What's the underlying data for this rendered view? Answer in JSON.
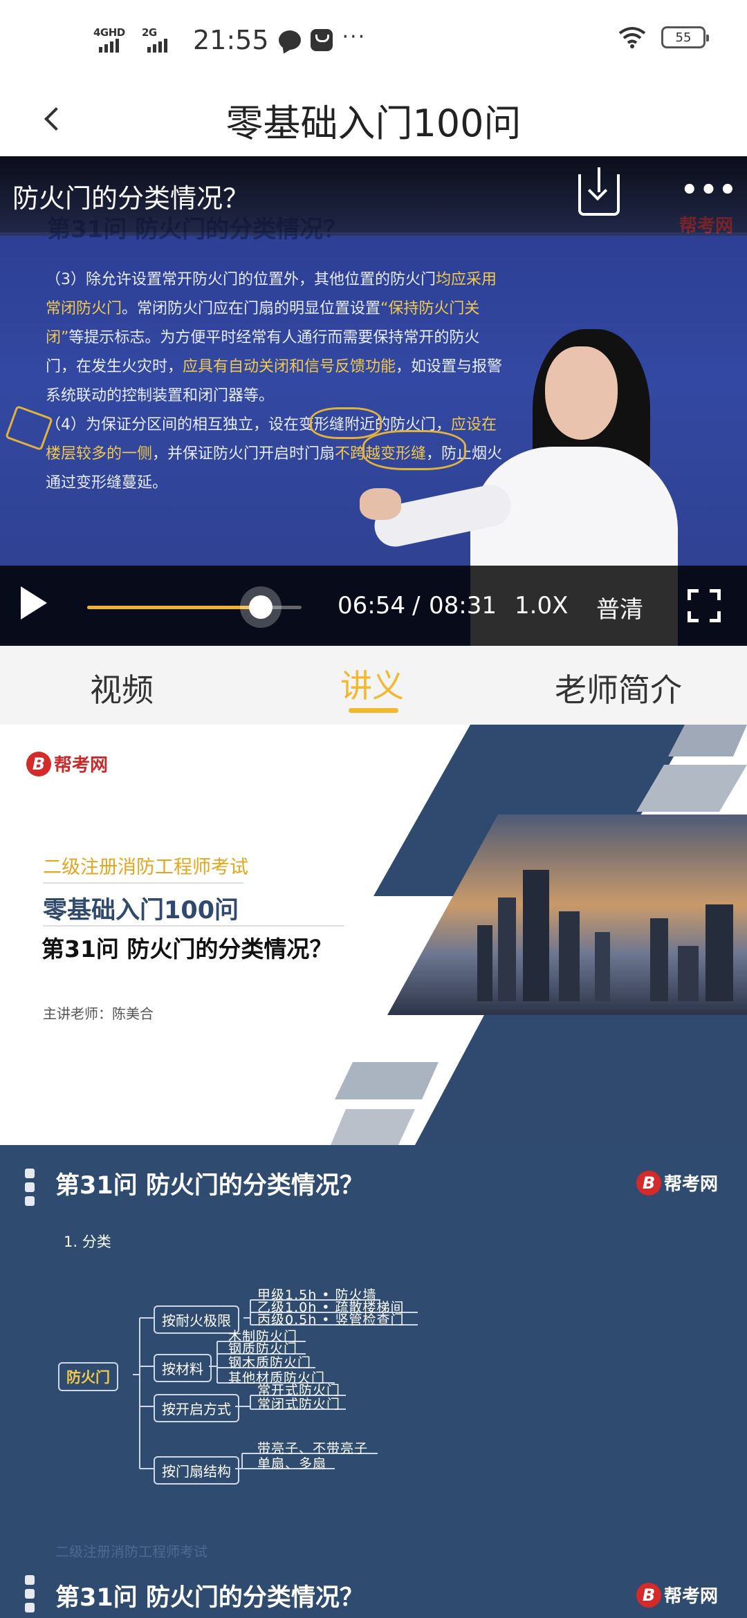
{
  "status_bar": {
    "net1": "4GHD",
    "net2": "2G",
    "time": "21:55",
    "more": "···",
    "battery": "55"
  },
  "header": {
    "title": "零基础入门100问"
  },
  "player": {
    "title": "防火门的分类情况？",
    "more": "•••",
    "current_time": "06:54",
    "separator": "/",
    "total_time": "08:31",
    "progress": 0.81,
    "speed": "1.0X",
    "quality": "普清",
    "slide": {
      "title": "第31问 防火门的分类情况？",
      "logo": "帮考网",
      "paragraph": [
        {
          "t": "（3）除允许设置常开防火门的位置外，其他位置的防火门",
          "h": false
        },
        {
          "t": "均应采用常闭防火门",
          "h": true
        },
        {
          "t": "。常闭防火门应在门扇的明显位置设置",
          "h": false
        },
        {
          "t": "“保持防火门关闭”",
          "h": true
        },
        {
          "t": "等提示标志。为方便平时经常有人通行而需要保持常开的防火门，在发生火灾时，",
          "h": false
        },
        {
          "t": "应具有自动关闭和信号反馈功能",
          "h": true
        },
        {
          "t": "，如设置与报警系统联动的控制装置和闭门器等。",
          "h": false
        },
        {
          "t": "（4）为保证分区间的相互独立，设在变形缝附近的防火门，",
          "h": false
        },
        {
          "t": "应设在楼层较多的一侧",
          "h": true
        },
        {
          "t": "，并保证防火门开启时门扇",
          "h": false
        },
        {
          "t": "不跨越变形缝",
          "h": true
        },
        {
          "t": "，防止烟火通过变形缝蔓延。",
          "h": false
        }
      ]
    }
  },
  "tabs": [
    {
      "label": "视频",
      "active": false
    },
    {
      "label": "讲义",
      "active": true
    },
    {
      "label": "老师简介",
      "active": false
    }
  ],
  "notes": {
    "cover": {
      "brand": "帮考网",
      "brand_mark": "B",
      "exam": "二级注册消防工程师考试",
      "course": "零基础入门100问",
      "lesson": "第31问  防火门的分类情况？",
      "teacher": "主讲老师：陈美合"
    },
    "slide": {
      "title": "第31问 防火门的分类情况？",
      "logo": "帮考网",
      "logo_mark": "B",
      "section": "1. 分类",
      "mindmap": {
        "root": "防火门",
        "branches": [
          {
            "label": "按耐火极限",
            "leaves": [
              "甲级1.5h  •  防火墙",
              "乙级1.0h  •  疏散楼梯间",
              "丙级0.5h  •  竖管检查门"
            ]
          },
          {
            "label": "按材料",
            "leaves": [
              "木制防火门",
              "钢质防火门",
              "钢木质防火门",
              "其他材质防火门"
            ]
          },
          {
            "label": "按开启方式",
            "leaves": [
              "常开式防火门",
              "常闭式防火门"
            ]
          },
          {
            "label": "按门扇结构",
            "leaves": [
              "带亮子、不带亮子",
              "单扇、多扇"
            ]
          }
        ]
      },
      "footer": "二级注册消防工程师考试"
    },
    "next_slide": {
      "title": "第31问 防火门的分类情况？",
      "logo": "帮考网"
    }
  },
  "colors": {
    "accent": "#f2b832",
    "slide_bg": "#2f4c70",
    "brand_red": "#d42a2a"
  }
}
